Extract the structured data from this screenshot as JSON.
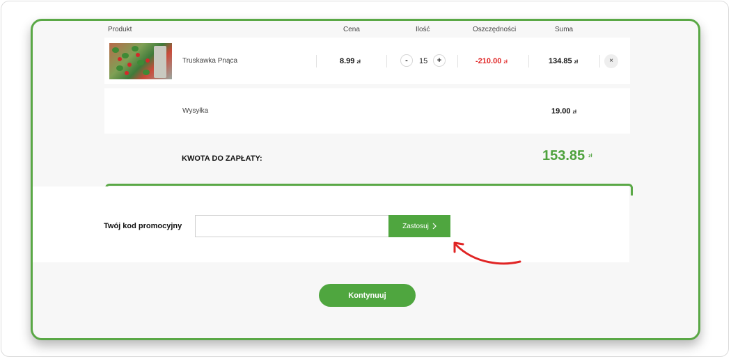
{
  "table": {
    "headers": {
      "product": "Produkt",
      "price": "Cena",
      "qty": "Ilość",
      "savings": "Oszczędności",
      "sum": "Suma"
    },
    "items": [
      {
        "name": "Truskawka Pnąca",
        "price": "8.99",
        "qty": "15",
        "savings": "-210.00",
        "sum": "134.85",
        "currency": "zł",
        "qty_minus": "-",
        "qty_plus": "+",
        "remove": "×"
      }
    ],
    "shipping": {
      "label": "Wysyłka",
      "value": "19.00",
      "currency": "zł"
    }
  },
  "total": {
    "label": "KWOTA DO ZAPŁATY:",
    "value": "153.85",
    "currency": "zł"
  },
  "promo": {
    "label": "Twój kod promocyjny",
    "input_value": "",
    "placeholder": "",
    "apply_label": "Zastosuj",
    "apply_icon": "chevron-right-icon"
  },
  "continue_label": "Kontynuuj",
  "colors": {
    "accent": "#4fa63f",
    "frame": "#5aa846",
    "savings": "#e02424",
    "annotation": "#e02424"
  }
}
